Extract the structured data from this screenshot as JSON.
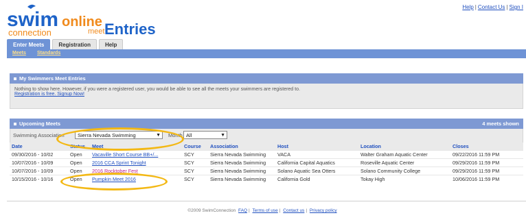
{
  "header": {
    "links": [
      "Help",
      "Contact Us",
      "Sign I"
    ],
    "logo_main": "swim",
    "logo_sub": "connection",
    "logo_online": "online",
    "logo_meet": "meet",
    "logo_entries": "Entries"
  },
  "tabs": [
    {
      "label": "Enter Meets",
      "active": true
    },
    {
      "label": "Registration",
      "active": false
    },
    {
      "label": "Help",
      "active": false
    }
  ],
  "subnav": [
    "Meets",
    "Standards"
  ],
  "my_entries": {
    "title": "My Swimmers Meet Entries",
    "message": "Nothing to show here. However, if you were a registered user, you would be able to see all the meets your swimmers are registered to.",
    "link": "Registration is free. Signup Now!"
  },
  "upcoming": {
    "title": "Upcoming Meets",
    "count_label": "4 meets shown",
    "assoc_label": "Swimming Association",
    "assoc_value": "Sierra Nevada Swimming",
    "month_label": "Month",
    "month_value": "All",
    "columns": [
      "Date",
      "Status",
      "Meet",
      "Course",
      "Association",
      "Host",
      "Location",
      "Closes"
    ],
    "rows": [
      {
        "date": "09/30/2016 - 10/02",
        "status": "Open",
        "meet": "Vacaville Short Course BB+/...",
        "course": "SCY",
        "association": "Sierra Nevada Swimming",
        "host": "VACA",
        "location": "Walter Graham Aquatic Center",
        "closes": "09/22/2016 11:59 PM"
      },
      {
        "date": "10/07/2016 - 10/09",
        "status": "Open",
        "meet": "2016 CCA Sprint Tonight",
        "course": "SCY",
        "association": "Sierra Nevada Swimming",
        "host": "California Capital Aquatics",
        "location": "Roseville Aquatic Center",
        "closes": "09/29/2016 11:59 PM"
      },
      {
        "date": "10/07/2016 - 10/09",
        "status": "Open",
        "meet": "2016 Rocktober Fest",
        "course": "SCY",
        "association": "Sierra Nevada Swimming",
        "host": "Solano Aquatic Sea Otters",
        "location": "Solano Community College",
        "closes": "09/29/2016 11:59 PM"
      },
      {
        "date": "10/15/2016 - 10/16",
        "status": "Open",
        "meet": "Pumpkin Meet 2016",
        "course": "SCY",
        "association": "Sierra Nevada Swimming",
        "host": "California Gold",
        "location": "Tokay High",
        "closes": "10/06/2016 11:59 PM"
      }
    ]
  },
  "footer": {
    "copyright": "©2009 SwimConnection",
    "links": [
      "FAQ",
      "Terms of use",
      "Contact us",
      "Privacy policy"
    ]
  },
  "colors": {
    "accent": "#6e93d6",
    "panel_header": "#7e99d3",
    "link": "#1f4fbf",
    "highlight_oval": "#f3b814",
    "logo_blue": "#1e63c8",
    "logo_orange": "#f08a1c"
  }
}
